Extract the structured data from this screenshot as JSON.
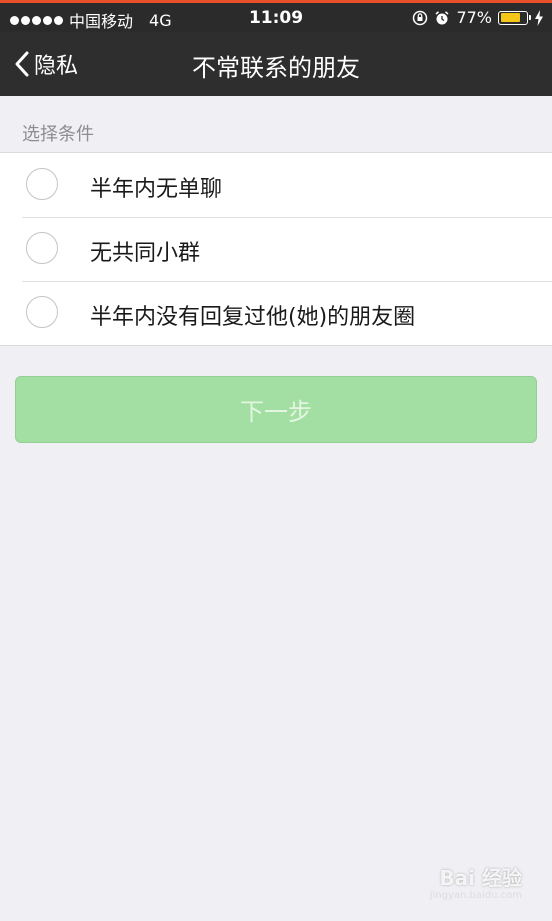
{
  "status_bar": {
    "carrier": "中国移动",
    "network": "4G",
    "time": "11:09",
    "battery_percent": "77%",
    "battery_level": 0.77,
    "icons": [
      "orientation-lock-icon",
      "alarm-icon",
      "charging-icon"
    ]
  },
  "nav": {
    "back_label": "隐私",
    "title": "不常联系的朋友"
  },
  "section": {
    "header": "选择条件"
  },
  "options": [
    {
      "label": "半年内无单聊",
      "selected": false
    },
    {
      "label": "无共同小群",
      "selected": false
    },
    {
      "label": "半年内没有回复过他(她)的朋友圈",
      "selected": false
    }
  ],
  "next_button": {
    "label": "下一步",
    "enabled": false
  },
  "watermark": {
    "brand": "Bai 经验",
    "sub": "jingyan.baidu.com"
  },
  "colors": {
    "accent_top": "#e8502a",
    "nav_background": "#2e2e2e",
    "button_disabled_green": "#a3dea2",
    "battery_yellow": "#f5c518",
    "page_background": "#efeff4"
  }
}
